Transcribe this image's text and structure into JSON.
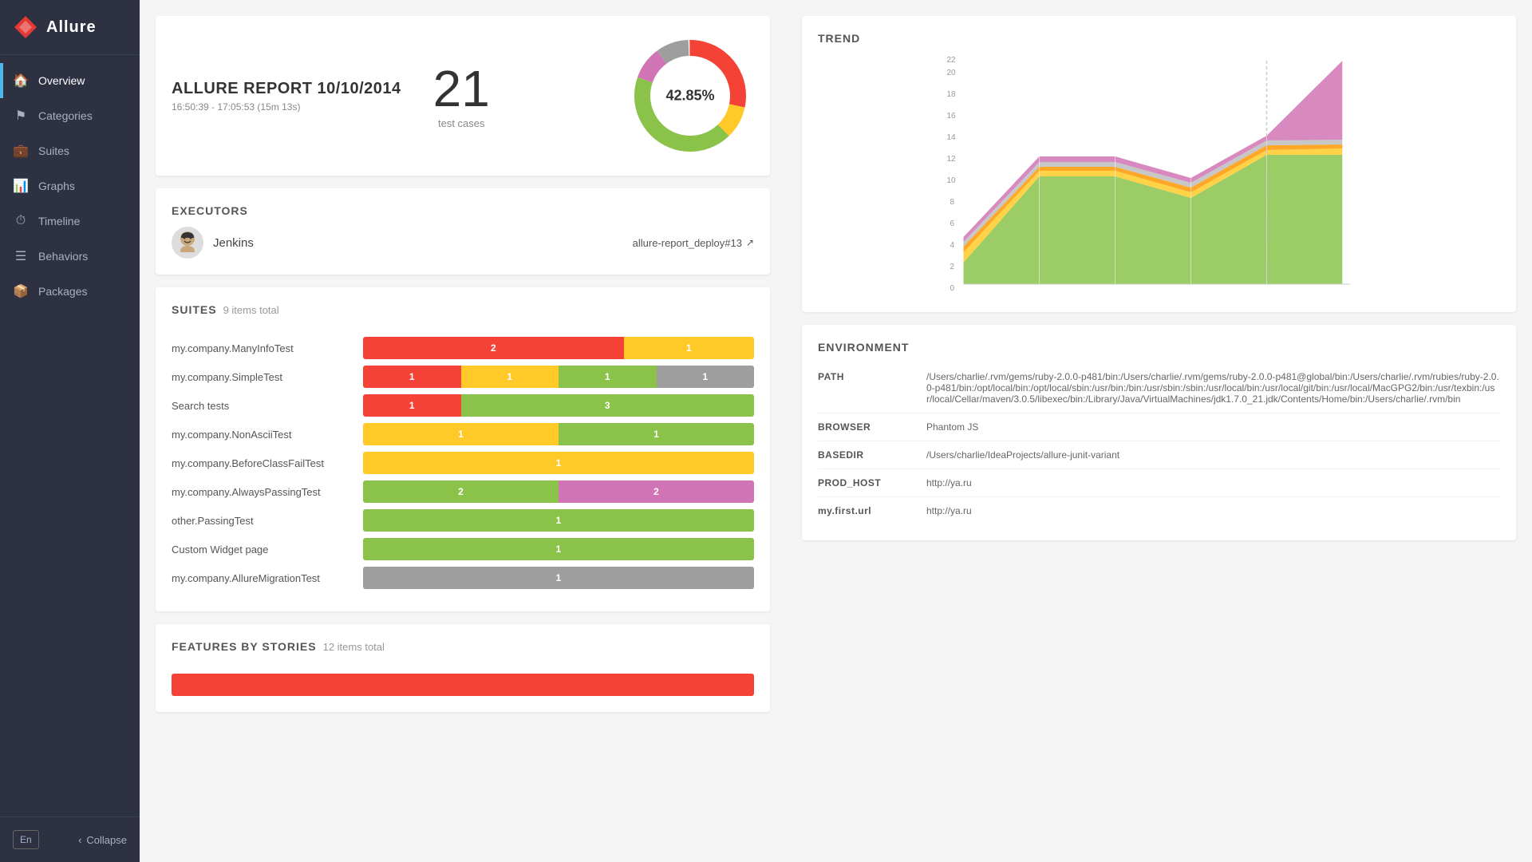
{
  "sidebar": {
    "logo": "Allure",
    "items": [
      {
        "id": "overview",
        "label": "Overview",
        "icon": "🏠",
        "active": true
      },
      {
        "id": "categories",
        "label": "Categories",
        "icon": "⚑",
        "active": false
      },
      {
        "id": "suites",
        "label": "Suites",
        "icon": "💼",
        "active": false
      },
      {
        "id": "graphs",
        "label": "Graphs",
        "icon": "📊",
        "active": false
      },
      {
        "id": "timeline",
        "label": "Timeline",
        "icon": "⏱",
        "active": false
      },
      {
        "id": "behaviors",
        "label": "Behaviors",
        "icon": "☰",
        "active": false
      },
      {
        "id": "packages",
        "label": "Packages",
        "icon": "📦",
        "active": false
      }
    ],
    "language": "En",
    "collapse_label": "Collapse"
  },
  "report": {
    "title": "ALLURE REPORT 10/10/2014",
    "time_range": "16:50:39 - 17:05:53 (15m 13s)",
    "test_count": "21",
    "test_label": "test cases",
    "donut_percent": "42.85%",
    "donut_segments": [
      {
        "color": "#f44336",
        "pct": 28.5
      },
      {
        "color": "#ffca28",
        "pct": 9.5
      },
      {
        "color": "#8bc34a",
        "pct": 42.85
      },
      {
        "color": "#d174b5",
        "pct": 9.5
      },
      {
        "color": "#9e9e9e",
        "pct": 9.65
      }
    ]
  },
  "executors": {
    "section_title": "EXECUTORS",
    "items": [
      {
        "name": "Jenkins",
        "build": "allure-report_deploy#13"
      }
    ]
  },
  "suites": {
    "section_title": "SUITES",
    "count_label": "9 items total",
    "items": [
      {
        "name": "my.company.ManyInfoTest",
        "segments": [
          {
            "color": "bar-red",
            "flex": 2,
            "label": "2"
          },
          {
            "color": "bar-yellow",
            "flex": 1,
            "label": "1"
          }
        ]
      },
      {
        "name": "my.company.SimpleTest",
        "segments": [
          {
            "color": "bar-red",
            "flex": 1,
            "label": "1"
          },
          {
            "color": "bar-yellow",
            "flex": 1,
            "label": "1"
          },
          {
            "color": "bar-green",
            "flex": 1,
            "label": "1"
          },
          {
            "color": "bar-gray",
            "flex": 1,
            "label": "1"
          }
        ]
      },
      {
        "name": "Search tests",
        "segments": [
          {
            "color": "bar-red",
            "flex": 1,
            "label": "1"
          },
          {
            "color": "bar-green",
            "flex": 3,
            "label": "3"
          }
        ]
      },
      {
        "name": "my.company.NonAsciiTest",
        "segments": [
          {
            "color": "bar-yellow",
            "flex": 1,
            "label": "1"
          },
          {
            "color": "bar-green",
            "flex": 1,
            "label": "1"
          }
        ]
      },
      {
        "name": "my.company.BeforeClassFailTest",
        "segments": [
          {
            "color": "bar-yellow",
            "flex": 1,
            "label": "1"
          }
        ]
      },
      {
        "name": "my.company.AlwaysPassingTest",
        "segments": [
          {
            "color": "bar-green",
            "flex": 2,
            "label": "2"
          },
          {
            "color": "bar-purple",
            "flex": 2,
            "label": "2"
          }
        ]
      },
      {
        "name": "other.PassingTest",
        "segments": [
          {
            "color": "bar-green",
            "flex": 1,
            "label": "1"
          }
        ]
      },
      {
        "name": "Custom Widget page",
        "segments": [
          {
            "color": "bar-green",
            "flex": 1,
            "label": "1"
          }
        ]
      },
      {
        "name": "my.company.AllureMigrationTest",
        "segments": [
          {
            "color": "bar-gray",
            "flex": 1,
            "label": "1"
          }
        ]
      }
    ]
  },
  "features": {
    "section_title": "FEATURES BY STORIES",
    "count_label": "12 items total"
  },
  "trend": {
    "title": "TREND",
    "y_labels": [
      "0",
      "2",
      "4",
      "6",
      "8",
      "10",
      "12",
      "14",
      "16",
      "18",
      "20",
      "22"
    ],
    "colors": {
      "red": "#f44336",
      "orange": "#ff9800",
      "yellow": "#ffca28",
      "green": "#8bc34a",
      "gray": "#bdbdbd",
      "purple": "#d174b5"
    }
  },
  "environment": {
    "section_title": "ENVIRONMENT",
    "items": [
      {
        "key": "PATH",
        "value": "/Users/charlie/.rvm/gems/ruby-2.0.0-p481/bin:/Users/charlie/.rvm/gems/ruby-2.0.0-p481@global/bin:/Users/charlie/.rvm/rubies/ruby-2.0.0-p481/bin:/opt/local/bin:/opt/local/sbin:/usr/bin:/bin:/usr/sbin:/sbin:/usr/local/bin:/usr/local/git/bin:/usr/local/MacGPG2/bin:/usr/texbin:/usr/local/Cellar/maven/3.0.5/libexec/bin:/Library/Java/VirtualMachines/jdk1.7.0_21.jdk/Contents/Home/bin:/Users/charlie/.rvm/bin"
      },
      {
        "key": "BROWSER",
        "value": "Phantom JS"
      },
      {
        "key": "BASEDIR",
        "value": "/Users/charlie/IdeaProjects/allure-junit-variant"
      },
      {
        "key": "PROD_HOST",
        "value": "http://ya.ru"
      },
      {
        "key": "my.first.url",
        "value": "http://ya.ru"
      }
    ]
  }
}
